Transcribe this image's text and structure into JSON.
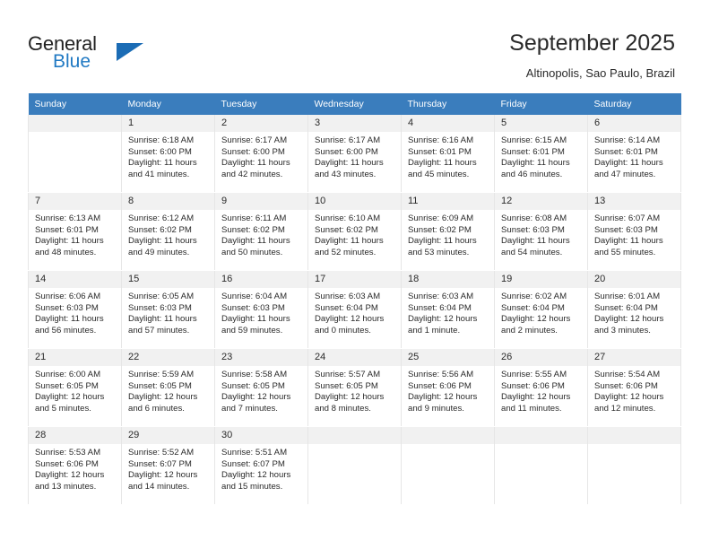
{
  "brand": {
    "name_part1": "General",
    "name_part2": "Blue",
    "flag_icon": "triangle-flag-icon"
  },
  "header": {
    "title": "September 2025",
    "subtitle": "Altinopolis, Sao Paulo, Brazil"
  },
  "calendar": {
    "weekdays": [
      "Sunday",
      "Monday",
      "Tuesday",
      "Wednesday",
      "Thursday",
      "Friday",
      "Saturday"
    ],
    "colors": {
      "header_bg": "#3a7dbd",
      "header_text": "#ffffff",
      "daynum_bg": "#f1f1f1",
      "cell_border": "#e6e6e6",
      "brand_blue": "#2079c3"
    },
    "weeks": [
      [
        {
          "day": "",
          "empty": true,
          "sunrise": "",
          "sunset": "",
          "daylight1": "",
          "daylight2": ""
        },
        {
          "day": "1",
          "sunrise": "Sunrise: 6:18 AM",
          "sunset": "Sunset: 6:00 PM",
          "daylight1": "Daylight: 11 hours",
          "daylight2": "and 41 minutes."
        },
        {
          "day": "2",
          "sunrise": "Sunrise: 6:17 AM",
          "sunset": "Sunset: 6:00 PM",
          "daylight1": "Daylight: 11 hours",
          "daylight2": "and 42 minutes."
        },
        {
          "day": "3",
          "sunrise": "Sunrise: 6:17 AM",
          "sunset": "Sunset: 6:00 PM",
          "daylight1": "Daylight: 11 hours",
          "daylight2": "and 43 minutes."
        },
        {
          "day": "4",
          "sunrise": "Sunrise: 6:16 AM",
          "sunset": "Sunset: 6:01 PM",
          "daylight1": "Daylight: 11 hours",
          "daylight2": "and 45 minutes."
        },
        {
          "day": "5",
          "sunrise": "Sunrise: 6:15 AM",
          "sunset": "Sunset: 6:01 PM",
          "daylight1": "Daylight: 11 hours",
          "daylight2": "and 46 minutes."
        },
        {
          "day": "6",
          "sunrise": "Sunrise: 6:14 AM",
          "sunset": "Sunset: 6:01 PM",
          "daylight1": "Daylight: 11 hours",
          "daylight2": "and 47 minutes."
        }
      ],
      [
        {
          "day": "7",
          "sunrise": "Sunrise: 6:13 AM",
          "sunset": "Sunset: 6:01 PM",
          "daylight1": "Daylight: 11 hours",
          "daylight2": "and 48 minutes."
        },
        {
          "day": "8",
          "sunrise": "Sunrise: 6:12 AM",
          "sunset": "Sunset: 6:02 PM",
          "daylight1": "Daylight: 11 hours",
          "daylight2": "and 49 minutes."
        },
        {
          "day": "9",
          "sunrise": "Sunrise: 6:11 AM",
          "sunset": "Sunset: 6:02 PM",
          "daylight1": "Daylight: 11 hours",
          "daylight2": "and 50 minutes."
        },
        {
          "day": "10",
          "sunrise": "Sunrise: 6:10 AM",
          "sunset": "Sunset: 6:02 PM",
          "daylight1": "Daylight: 11 hours",
          "daylight2": "and 52 minutes."
        },
        {
          "day": "11",
          "sunrise": "Sunrise: 6:09 AM",
          "sunset": "Sunset: 6:02 PM",
          "daylight1": "Daylight: 11 hours",
          "daylight2": "and 53 minutes."
        },
        {
          "day": "12",
          "sunrise": "Sunrise: 6:08 AM",
          "sunset": "Sunset: 6:03 PM",
          "daylight1": "Daylight: 11 hours",
          "daylight2": "and 54 minutes."
        },
        {
          "day": "13",
          "sunrise": "Sunrise: 6:07 AM",
          "sunset": "Sunset: 6:03 PM",
          "daylight1": "Daylight: 11 hours",
          "daylight2": "and 55 minutes."
        }
      ],
      [
        {
          "day": "14",
          "sunrise": "Sunrise: 6:06 AM",
          "sunset": "Sunset: 6:03 PM",
          "daylight1": "Daylight: 11 hours",
          "daylight2": "and 56 minutes."
        },
        {
          "day": "15",
          "sunrise": "Sunrise: 6:05 AM",
          "sunset": "Sunset: 6:03 PM",
          "daylight1": "Daylight: 11 hours",
          "daylight2": "and 57 minutes."
        },
        {
          "day": "16",
          "sunrise": "Sunrise: 6:04 AM",
          "sunset": "Sunset: 6:03 PM",
          "daylight1": "Daylight: 11 hours",
          "daylight2": "and 59 minutes."
        },
        {
          "day": "17",
          "sunrise": "Sunrise: 6:03 AM",
          "sunset": "Sunset: 6:04 PM",
          "daylight1": "Daylight: 12 hours",
          "daylight2": "and 0 minutes."
        },
        {
          "day": "18",
          "sunrise": "Sunrise: 6:03 AM",
          "sunset": "Sunset: 6:04 PM",
          "daylight1": "Daylight: 12 hours",
          "daylight2": "and 1 minute."
        },
        {
          "day": "19",
          "sunrise": "Sunrise: 6:02 AM",
          "sunset": "Sunset: 6:04 PM",
          "daylight1": "Daylight: 12 hours",
          "daylight2": "and 2 minutes."
        },
        {
          "day": "20",
          "sunrise": "Sunrise: 6:01 AM",
          "sunset": "Sunset: 6:04 PM",
          "daylight1": "Daylight: 12 hours",
          "daylight2": "and 3 minutes."
        }
      ],
      [
        {
          "day": "21",
          "sunrise": "Sunrise: 6:00 AM",
          "sunset": "Sunset: 6:05 PM",
          "daylight1": "Daylight: 12 hours",
          "daylight2": "and 5 minutes."
        },
        {
          "day": "22",
          "sunrise": "Sunrise: 5:59 AM",
          "sunset": "Sunset: 6:05 PM",
          "daylight1": "Daylight: 12 hours",
          "daylight2": "and 6 minutes."
        },
        {
          "day": "23",
          "sunrise": "Sunrise: 5:58 AM",
          "sunset": "Sunset: 6:05 PM",
          "daylight1": "Daylight: 12 hours",
          "daylight2": "and 7 minutes."
        },
        {
          "day": "24",
          "sunrise": "Sunrise: 5:57 AM",
          "sunset": "Sunset: 6:05 PM",
          "daylight1": "Daylight: 12 hours",
          "daylight2": "and 8 minutes."
        },
        {
          "day": "25",
          "sunrise": "Sunrise: 5:56 AM",
          "sunset": "Sunset: 6:06 PM",
          "daylight1": "Daylight: 12 hours",
          "daylight2": "and 9 minutes."
        },
        {
          "day": "26",
          "sunrise": "Sunrise: 5:55 AM",
          "sunset": "Sunset: 6:06 PM",
          "daylight1": "Daylight: 12 hours",
          "daylight2": "and 11 minutes."
        },
        {
          "day": "27",
          "sunrise": "Sunrise: 5:54 AM",
          "sunset": "Sunset: 6:06 PM",
          "daylight1": "Daylight: 12 hours",
          "daylight2": "and 12 minutes."
        }
      ],
      [
        {
          "day": "28",
          "sunrise": "Sunrise: 5:53 AM",
          "sunset": "Sunset: 6:06 PM",
          "daylight1": "Daylight: 12 hours",
          "daylight2": "and 13 minutes."
        },
        {
          "day": "29",
          "sunrise": "Sunrise: 5:52 AM",
          "sunset": "Sunset: 6:07 PM",
          "daylight1": "Daylight: 12 hours",
          "daylight2": "and 14 minutes."
        },
        {
          "day": "30",
          "sunrise": "Sunrise: 5:51 AM",
          "sunset": "Sunset: 6:07 PM",
          "daylight1": "Daylight: 12 hours",
          "daylight2": "and 15 minutes."
        },
        {
          "day": "",
          "empty": true,
          "sunrise": "",
          "sunset": "",
          "daylight1": "",
          "daylight2": ""
        },
        {
          "day": "",
          "empty": true,
          "sunrise": "",
          "sunset": "",
          "daylight1": "",
          "daylight2": ""
        },
        {
          "day": "",
          "empty": true,
          "sunrise": "",
          "sunset": "",
          "daylight1": "",
          "daylight2": ""
        },
        {
          "day": "",
          "empty": true,
          "sunrise": "",
          "sunset": "",
          "daylight1": "",
          "daylight2": ""
        }
      ]
    ]
  }
}
